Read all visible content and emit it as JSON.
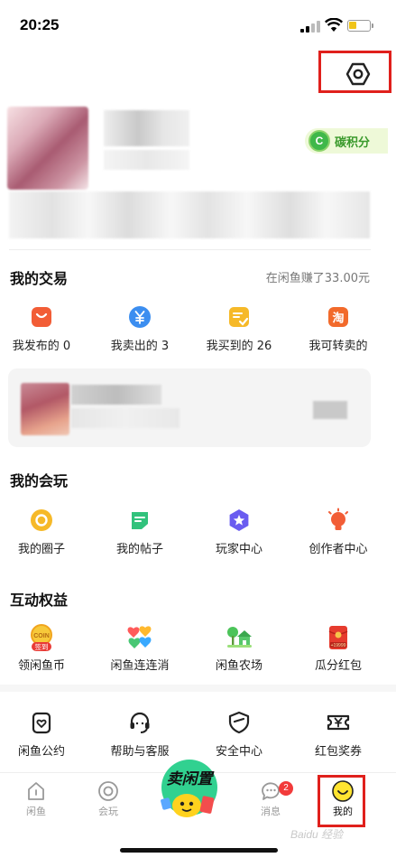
{
  "status": {
    "time": "20:25",
    "battery_level": 0.4
  },
  "profile": {
    "carbon_label": "碳积分"
  },
  "trade": {
    "title": "我的交易",
    "earn_text": "在闲鱼赚了33.00元",
    "items": [
      {
        "label": "我发布的 0",
        "icon": "bag-icon",
        "color": "#f25d36"
      },
      {
        "label": "我卖出的 3",
        "icon": "yen-icon",
        "color": "#3c8ef0"
      },
      {
        "label": "我买到的 26",
        "icon": "check-list-icon",
        "color": "#f6b928"
      },
      {
        "label": "我可转卖的",
        "icon": "taobao-icon",
        "color": "#f26a2b"
      }
    ]
  },
  "play": {
    "title": "我的会玩",
    "items": [
      {
        "label": "我的圈子",
        "icon": "circle-icon",
        "color": "#f6b928"
      },
      {
        "label": "我的帖子",
        "icon": "post-icon",
        "color": "#31c27c"
      },
      {
        "label": "玩家中心",
        "icon": "star-icon",
        "color": "#6a5cf0"
      },
      {
        "label": "创作者中心",
        "icon": "bulb-icon",
        "color": "#f25d36"
      }
    ]
  },
  "rights": {
    "title": "互动权益",
    "items": [
      {
        "label": "领闲鱼币",
        "icon": "coin-checkin-icon",
        "badge": "签到"
      },
      {
        "label": "闲鱼连连消",
        "icon": "hearts-icon"
      },
      {
        "label": "闲鱼农场",
        "icon": "farm-icon"
      },
      {
        "label": "瓜分红包",
        "icon": "red-packet-icon",
        "badge": "+19999"
      }
    ]
  },
  "services": {
    "items": [
      {
        "label": "闲鱼公约",
        "icon": "shield-heart-icon"
      },
      {
        "label": "帮助与客服",
        "icon": "headset-icon"
      },
      {
        "label": "安全中心",
        "icon": "shield-icon"
      },
      {
        "label": "红包奖券",
        "icon": "ticket-icon"
      }
    ]
  },
  "tabbar": {
    "tabs": [
      {
        "label": "闲鱼",
        "icon": "home-icon"
      },
      {
        "label": "会玩",
        "icon": "circle-icon"
      },
      {
        "label": "消息",
        "icon": "message-icon",
        "badge": "2"
      },
      {
        "label": "我的",
        "icon": "smile-icon"
      }
    ],
    "center_label": "卖闲置"
  },
  "watermark": "Baidu 经验",
  "colors": {
    "accent_yellow": "#ffe431",
    "highlight_red": "#e0201c",
    "carbon_green": "#3fb84a"
  }
}
